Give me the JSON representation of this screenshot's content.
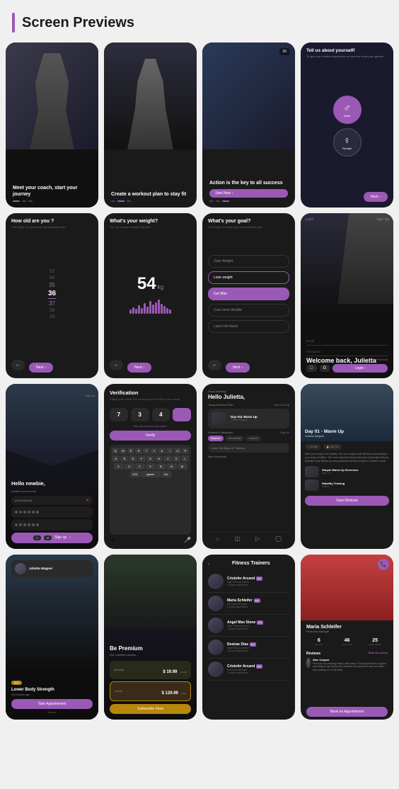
{
  "header": {
    "title": "Screen Previews",
    "accent_color": "#9b59b6"
  },
  "row1": {
    "card1": {
      "main_text": "Meet your coach,\nstart your journey",
      "dots": [
        "active",
        "inactive",
        "inactive"
      ]
    },
    "card2": {
      "main_text": "Create a workout plan\nto stay fit",
      "dots": [
        "inactive",
        "active",
        "inactive"
      ]
    },
    "card3": {
      "main_text": "Action is the\nkey to all success",
      "btn_label": "Start Now",
      "dots": [
        "inactive",
        "inactive",
        "active"
      ]
    },
    "card4": {
      "title": "Tell us about yourself!",
      "subtitle": "To give you a better experience we need to know your gender",
      "male_label": "Male",
      "female_label": "Female",
      "next_label": "Next"
    }
  },
  "row2": {
    "card1": {
      "title": "How old are you ?",
      "subtitle": "This helps us create your personalized plan",
      "ages": [
        "33",
        "34",
        "35",
        "36",
        "37",
        "38",
        "39"
      ],
      "selected": "36",
      "back_label": "←",
      "next_label": "Next"
    },
    "card2": {
      "title": "What's your weight?",
      "subtitle": "You can always change this later",
      "weight": "54",
      "unit": "kg",
      "back_label": "←",
      "next_label": "Next"
    },
    "card3": {
      "title": "What's your goal?",
      "subtitle": "This helps us create your personalized plan",
      "options": [
        "Gain Weight",
        "Lose weight",
        "Get fitter",
        "Gain more flexible",
        "Learn the basic"
      ],
      "selected": "Get fitter",
      "back_label": "←",
      "next_label": "Next"
    },
    "card4": {
      "welcome_text": "Welcome back,\nJulietta",
      "email_placeholder": "Email",
      "password_placeholder": "Password",
      "forgot_label": "Forgot Password",
      "login_label": "Login"
    }
  },
  "row3": {
    "card1": {
      "title": "Hello newbie,",
      "subtitle": "create your account",
      "email_placeholder": "juls234@mail",
      "pass_dots": 6,
      "signup_label": "Sign up"
    },
    "card2": {
      "title": "Verification",
      "subtitle": "Check your email. We've sent you the PIN in your email.",
      "code": [
        "7",
        "3",
        "4"
      ],
      "resend_text": "See you receive any code?",
      "verify_label": "Verify",
      "keyboard_rows": [
        [
          "Q",
          "W",
          "E",
          "R",
          "T",
          "Y",
          "U",
          "I",
          "O",
          "P"
        ],
        [
          "A",
          "S",
          "D",
          "F",
          "G",
          "H",
          "J",
          "K",
          "L"
        ],
        [
          "Z",
          "X",
          "C",
          "V",
          "B",
          "N",
          "M"
        ]
      ]
    },
    "card3": {
      "greeting": "Good morning",
      "title": "Hello Julietta,",
      "plan_label": "Today Workout Plan",
      "workout_day": "Day 911 Warm Up",
      "categories_label": "Workout Categories",
      "categories": [
        "Beginner",
        "Intermediate",
        "Advance"
      ],
      "learn_label": "Learn the Basic of Training",
      "new_workouts_label": "New Workouts"
    },
    "card4": {
      "day_label": "Day 01 - Warm Up",
      "trainer": "Julietta Wagner",
      "stats": [
        "40 min",
        "305 Cal"
      ],
      "desc": "Want your body to be healthy. Join our program with directions according to your body condition. The most important thing is the goal of strength training. Maintain body fitness by doing physical exercise at least 2-3 times a week.",
      "exercise1": "Simple Warm Up Exercises",
      "exercise2": "Stability Training",
      "start_btn": "Start Workout"
    }
  },
  "row4": {
    "card1": {
      "title": "Lower Body Strength",
      "subtitle": "110 minutes ago",
      "tag": "NEW",
      "appt_btn": "Take Appointment",
      "cancel_label": "Cancel"
    },
    "card2": {
      "title": "Be Premium",
      "subtitle": "Get unlimited access...",
      "plan1_label": "Monthly",
      "plan1_price": "$ 19.99",
      "plan1_per": "/month",
      "plan2_label": "Yearly",
      "plan2_price": "$ 129.99",
      "plan2_per": "/year",
      "subscribe_label": "Subscribe Now"
    },
    "card3": {
      "title": "Fitness Trainers",
      "trainers": [
        {
          "name": "Cristofer Arcand",
          "badge": "Pro",
          "spec": "High Fitness Trainer",
          "rating": "4 years experience"
        },
        {
          "name": "Maria Schleifer",
          "badge": "Pro",
          "spec": "Personal Strength",
          "rating": "5 years experience"
        },
        {
          "name": "Angel Max Stone",
          "badge": "Pro",
          "spec": "High Fitness Trainer",
          "rating": "3 years experience"
        },
        {
          "name": "Desirae Dias",
          "badge": "Pro",
          "spec": "High Fitness Trainer",
          "rating": "4 years experience"
        },
        {
          "name": "Cristofer Arcand",
          "badge": "Pro",
          "spec": "Personal Strength",
          "rating": "2 years experience"
        }
      ]
    },
    "card4": {
      "name": "Maria Schleifer",
      "spec": "Personal Strength",
      "stats": [
        {
          "num": "6",
          "label": "Courses"
        },
        {
          "num": "46",
          "label": "Active Days"
        },
        {
          "num": "25",
          "label": "Active Marks"
        }
      ],
      "reviews_label": "Reviews",
      "reviewer": "Alex Cooper",
      "review_text": "Felt such an amazing lesson with Maria. She adjusted her program according to my needs and adjusted his workout to suit me better then putting me in his limits.",
      "book_btn": "Book an Appointment"
    }
  }
}
